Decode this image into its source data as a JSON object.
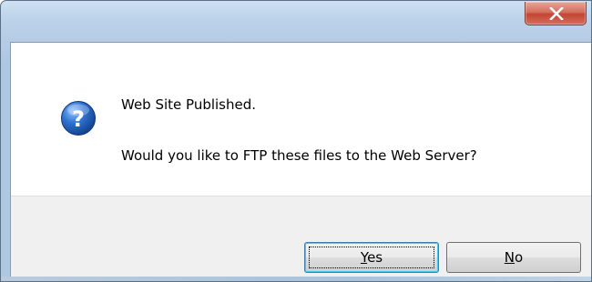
{
  "dialog": {
    "title": "",
    "close_icon": "close-x-icon",
    "message_icon": "question-icon",
    "message_line1": "Web Site Published.",
    "message_line2": "Would you like to FTP these files to the Web Server?",
    "buttons": {
      "yes": {
        "mnemonic": "Y",
        "rest": "es"
      },
      "no": {
        "mnemonic": "N",
        "rest": "o"
      }
    },
    "default_button": "yes"
  },
  "colors": {
    "frame": "#b6cde5",
    "close_button": "#c34533",
    "footer": "#f0f0f0",
    "icon_blue": "#1f5fb5"
  }
}
